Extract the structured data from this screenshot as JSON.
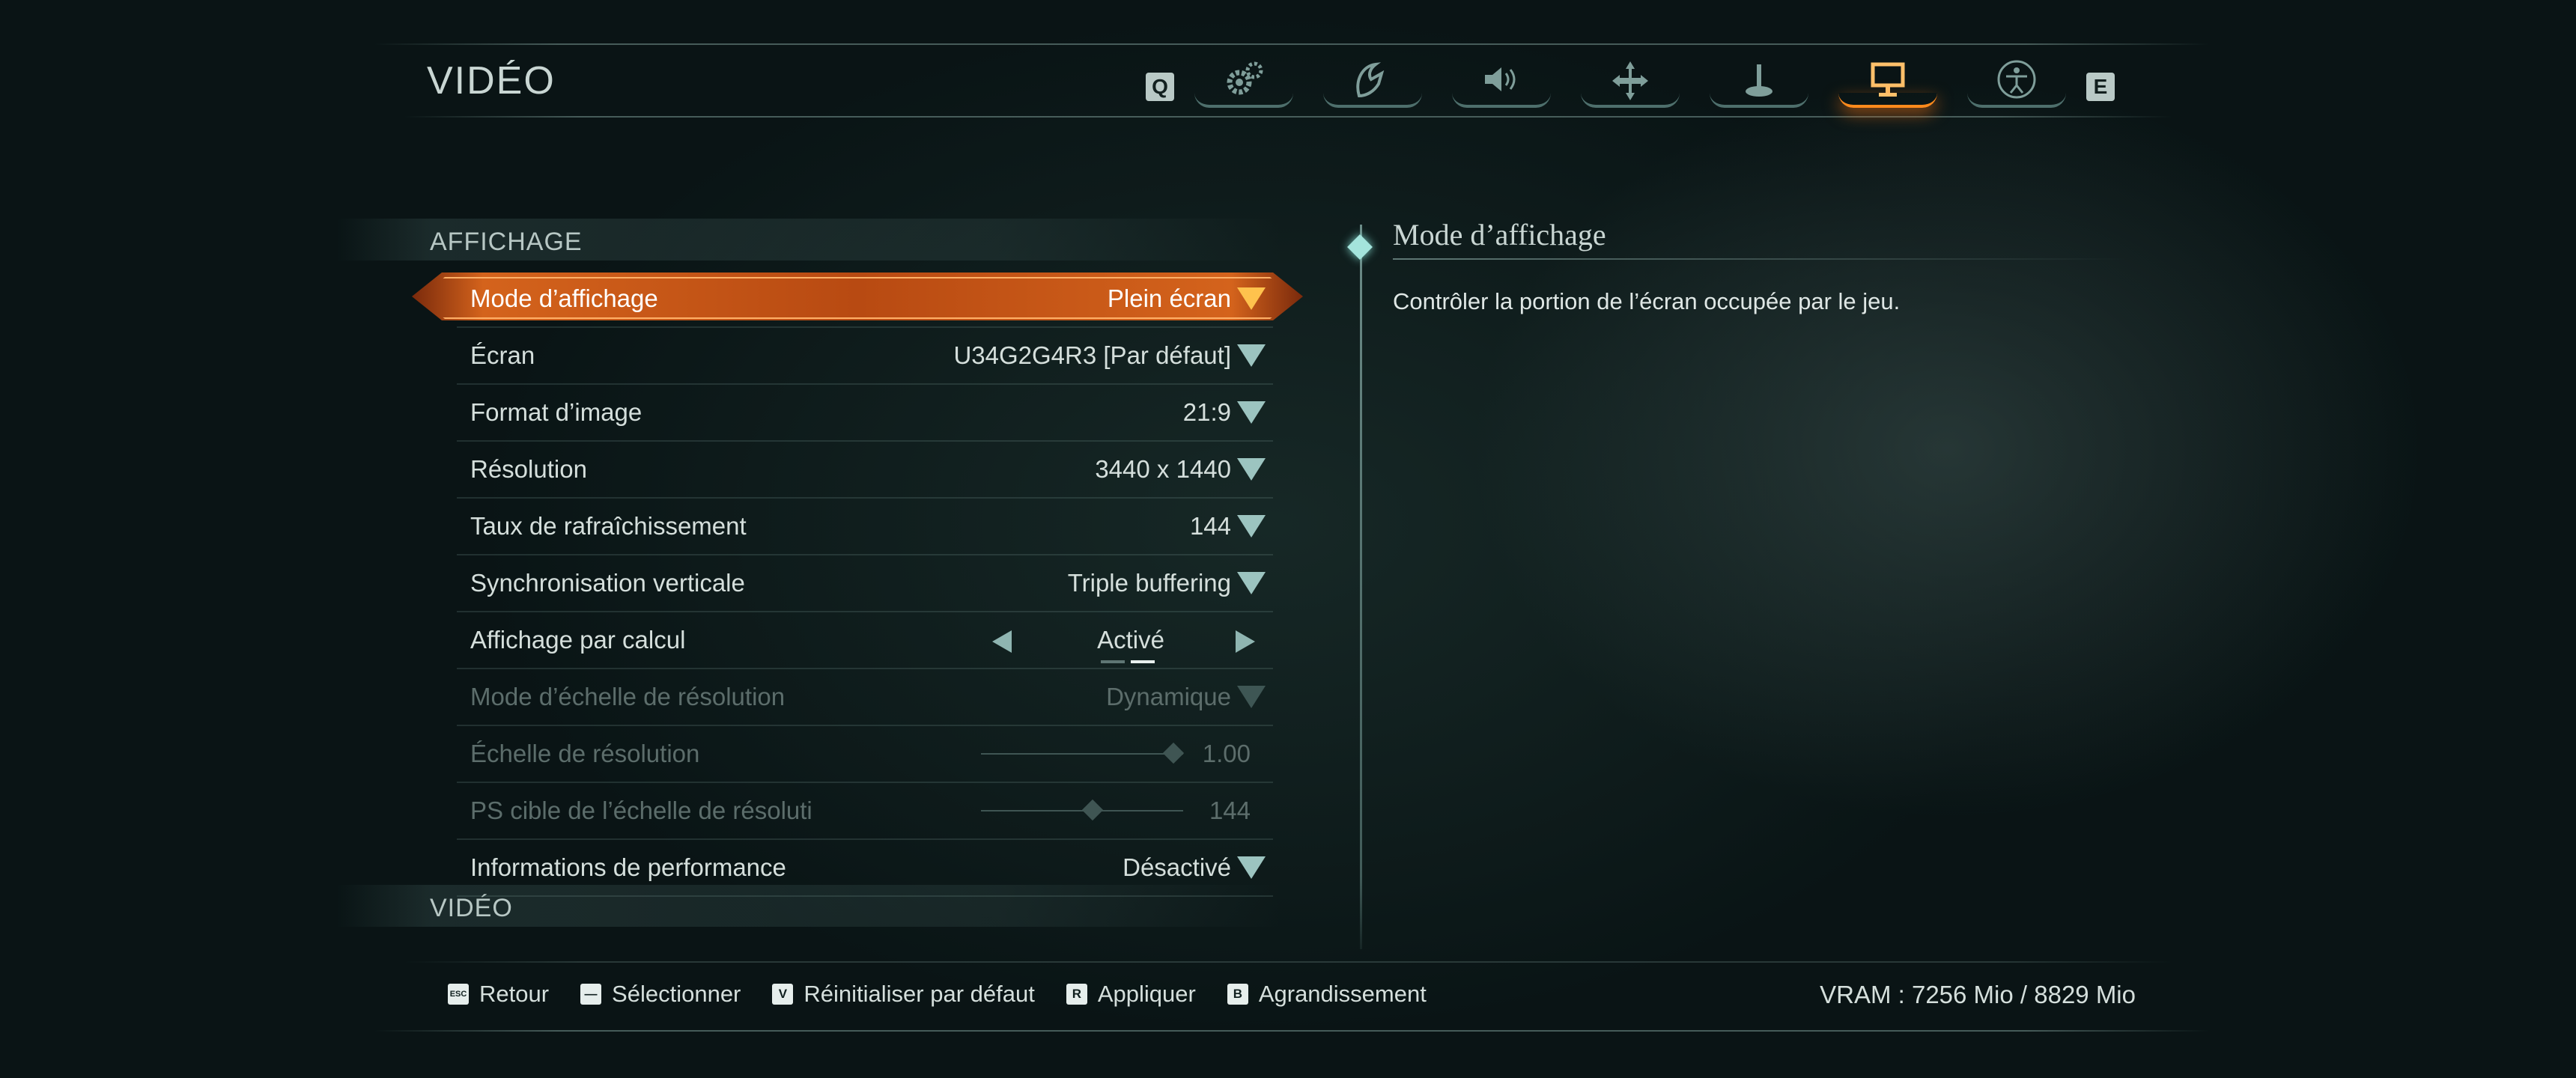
{
  "header": {
    "title": "VIDÉO",
    "prev_key": "Q",
    "next_key": "E",
    "tabs": [
      {
        "icon": "gears-icon",
        "active": false
      },
      {
        "icon": "hand-icon",
        "active": false
      },
      {
        "icon": "speaker-icon",
        "active": false
      },
      {
        "icon": "move-icon",
        "active": false
      },
      {
        "icon": "joystick-icon",
        "active": false
      },
      {
        "icon": "monitor-icon",
        "active": true
      },
      {
        "icon": "accessibility-icon",
        "active": false
      }
    ]
  },
  "sections": {
    "display": "AFFICHAGE",
    "video": "VIDÉO"
  },
  "settings": {
    "display_mode": {
      "label": "Mode d’affichage",
      "value": "Plein écran"
    },
    "screen": {
      "label": "Écran",
      "value": "U34G2G4R3 [Par défaut]"
    },
    "aspect_ratio": {
      "label": "Format d’image",
      "value": "21:9"
    },
    "resolution": {
      "label": "Résolution",
      "value": "3440 x 1440"
    },
    "refresh_rate": {
      "label": "Taux de rafraîchissement",
      "value": "144"
    },
    "vsync": {
      "label": "Synchronisation verticale",
      "value": "Triple buffering"
    },
    "compute_display": {
      "label": "Affichage par calcul",
      "value": "Activé"
    },
    "res_scale_mode": {
      "label": "Mode d’échelle de résolution",
      "value": "Dynamique"
    },
    "res_scale": {
      "label": "Échelle de résolution",
      "value": "1.00",
      "level": 0.95
    },
    "res_scale_target_fps": {
      "label": "PS cible de l’échelle de résoluti",
      "value": "144",
      "level": 0.55
    },
    "perf_info": {
      "label": "Informations de performance",
      "value": "Désactivé"
    }
  },
  "help": {
    "title": "Mode d’affichage",
    "text": "Contrôler la portion de l’écran occupée par le jeu."
  },
  "footer": {
    "back": {
      "key": "ESC",
      "label": "Retour"
    },
    "select": {
      "key": "—",
      "label": "Sélectionner"
    },
    "reset": {
      "key": "V",
      "label": "Réinitialiser par défaut"
    },
    "apply": {
      "key": "R",
      "label": "Appliquer"
    },
    "zoom": {
      "key": "B",
      "label": "Agrandissement"
    },
    "vram": "VRAM : 7256 Mio / 8829 Mio"
  },
  "colors": {
    "accent": "#e06a1e",
    "teal": "#9cc4c0"
  }
}
